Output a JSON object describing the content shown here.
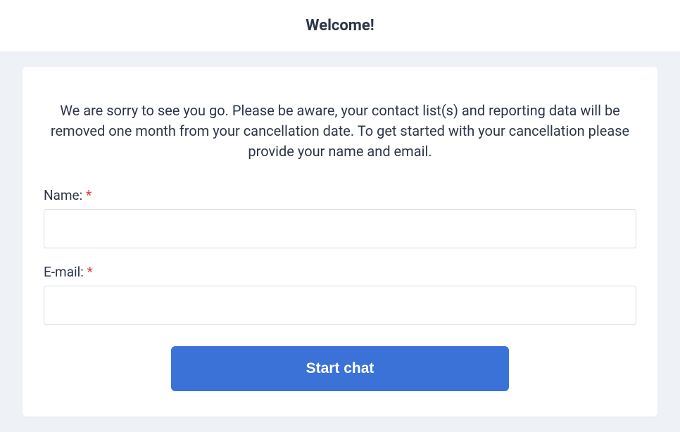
{
  "header": {
    "title": "Welcome!"
  },
  "card": {
    "intro": "We are sorry to see you go. Please be aware, your contact list(s) and reporting data will be removed one month from your cancellation date. To get started with your cancellation please provide your name and email.",
    "fields": {
      "name": {
        "label": "Name: ",
        "required_mark": "*",
        "value": ""
      },
      "email": {
        "label": "E-mail: ",
        "required_mark": "*",
        "value": ""
      }
    },
    "button_label": "Start chat"
  }
}
